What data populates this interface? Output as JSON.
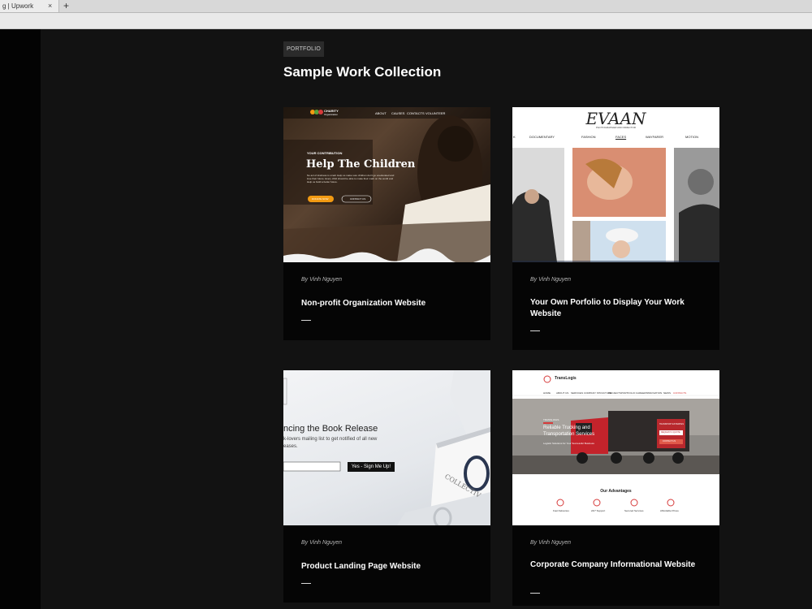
{
  "browser": {
    "tab_title": "g | Upwork",
    "close_glyph": "×",
    "new_tab_glyph": "+"
  },
  "portfolio": {
    "badge": "PORTFOLIO",
    "heading": "Sample Work Collection",
    "cards": [
      {
        "author": "By Vinh Nguyen",
        "title": "Non-profit Organization Website",
        "thumb": {
          "logo": "CHARITY",
          "logo_sub": "Organization",
          "nav": [
            "ABOUT",
            "CAUSES",
            "CONTACTS",
            "VOLUNTEER"
          ],
          "kicker": "YOUR CONTRIBUTION",
          "headline": "Help The Children",
          "body": "No act of kindness is small. Help us make sure children don't go uneducated and lose their future. Every child should be able to make their mark on the world and Help us build a better future.",
          "btn1": "DONATE NOW",
          "btn2": "CONTACT US"
        }
      },
      {
        "author": "By Vinh Nguyen",
        "title": "Your Own Porfolio to Display Your Work Website",
        "thumb": {
          "logo": "EVAAN",
          "logo_sub": "PHOTOGRAPHER AND DIRECTOR",
          "nav": [
            "K",
            "DOCUMENTARY",
            "FASHION",
            "FACES",
            "WAYFARER",
            "MOTION"
          ]
        }
      },
      {
        "author": "By Vinh Nguyen",
        "title": "Product Landing Page Website",
        "thumb": {
          "headline": "ncing the Book Release",
          "sub1": "k-lovers mailing list to get notified of all new",
          "sub2": "eases.",
          "button": "Yes - Sign Me Up!",
          "book_text": "COLLECTIV"
        }
      },
      {
        "author": "By Vinh Nguyen",
        "title": "Corporate Company Informational Website",
        "thumb": {
          "logo": "TransLogis",
          "nav": [
            "HOME",
            "ABOUT US",
            "SERVICES",
            "COMPANY STRUCTURE",
            "PROJECTS",
            "PORTFOLIO",
            "CAREERS",
            "INNOVATION",
            "NEWS",
            "CONTACTS"
          ],
          "kicker": "TRANSLOGIS",
          "headline1": "Reliable Trucking and",
          "headline2": "Transportation Services",
          "sub": "Logistic Solutions for Your Successful Business",
          "box_title": "TRANSPORT ESTIMATES",
          "box_btn1": "REQUEST A QUOTE",
          "box_btn2": "CONTACT US",
          "advantages_title": "Our Advantages",
          "advantages": [
            "Fast Deliveries",
            "24/7 Support",
            "Secured Services",
            "Affordable Prices"
          ]
        }
      }
    ]
  },
  "colors": {
    "page_bg": "#121212",
    "card_bg": "#050505",
    "accent_orange": "#f29a12",
    "accent_red": "#d63a3a"
  }
}
